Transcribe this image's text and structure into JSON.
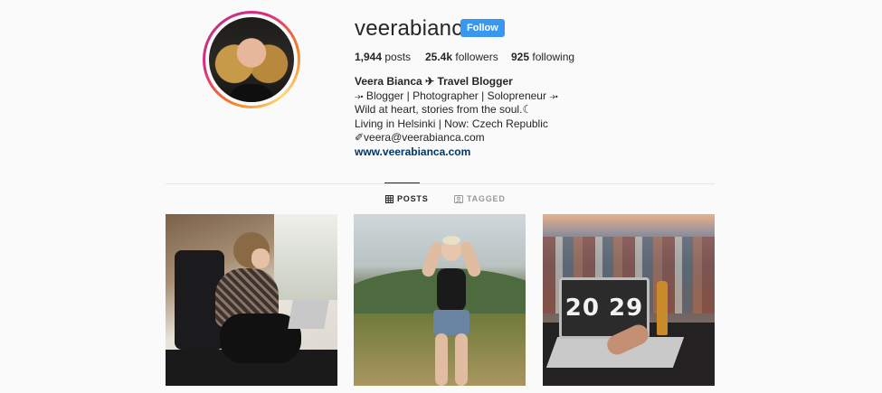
{
  "profile": {
    "username": "veerabianca",
    "follow_label": "Follow",
    "stats": {
      "posts_count": "1,944",
      "posts_label": " posts",
      "followers_count": "25.4k",
      "followers_label": " followers",
      "following_count": "925",
      "following_label": " following"
    },
    "bio": {
      "name": "Veera Bianca ✈ Travel Blogger",
      "line1": "⤞ Blogger | Photographer | Solopreneur ⤞",
      "line2": "Wild at heart, stories from the soul.☾",
      "line3": "Living in Helsinki | Now: Czech Republic",
      "line4": "✐veera@veerabianca.com",
      "website": "www.veerabianca.com"
    }
  },
  "tabs": [
    {
      "label": "POSTS",
      "icon": "grid-icon",
      "active": true
    },
    {
      "label": "TAGGED",
      "icon": "tagged-icon",
      "active": false
    }
  ],
  "posts": [
    {
      "name": "post-train-laptop"
    },
    {
      "name": "post-hillside"
    },
    {
      "name": "post-laptop-rooftop",
      "clock_text": "20 29"
    }
  ],
  "colors": {
    "follow_button": "#3897f0",
    "link": "#003569",
    "text": "#262626",
    "muted": "#999999",
    "background": "#fafafa"
  }
}
